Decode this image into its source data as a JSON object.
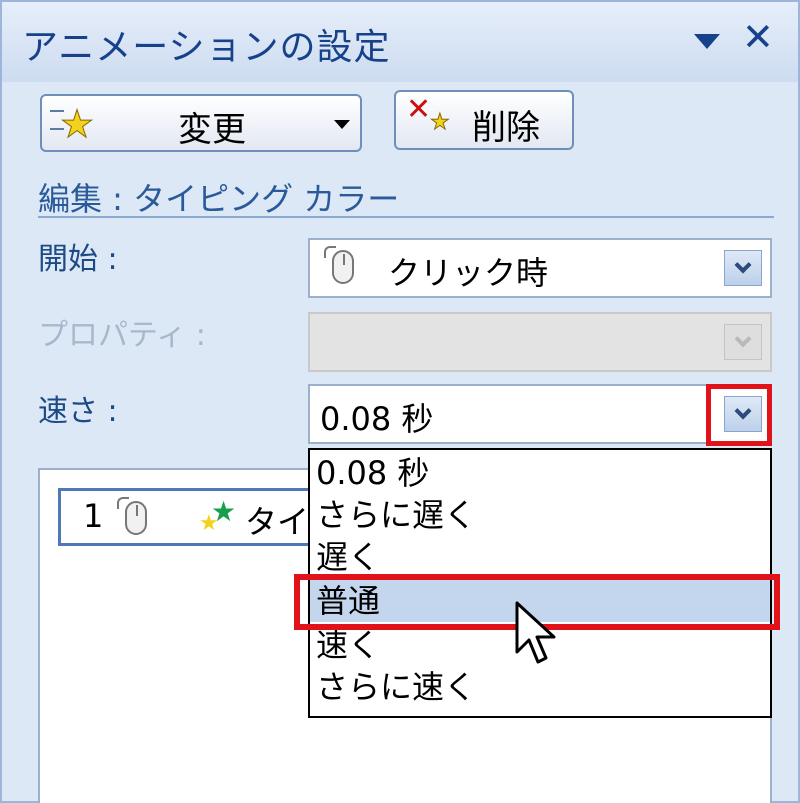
{
  "title": "アニメーションの設定",
  "buttons": {
    "change_label": "変更",
    "delete_label": "削除"
  },
  "section_title": "編集 : タイピング カラー",
  "fields": {
    "start_label": "開始 :",
    "start_value": "クリック時",
    "property_label": "プロパティ :",
    "property_value": "",
    "speed_label": "速さ :",
    "speed_value": "0.08 秒"
  },
  "speed_options": [
    "0.08 秒",
    "さらに遅く",
    "遅く",
    "普通",
    "速く",
    "さらに速く"
  ],
  "selected_option": "普通",
  "animation_list": [
    {
      "number": "1",
      "name": "タイピング カラー"
    }
  ],
  "icons": [
    "menu-arrow-icon",
    "close-icon",
    "star-icon",
    "x-icon",
    "mouse-icon",
    "chevron-down-icon",
    "pointer-cursor-icon"
  ],
  "colors": {
    "title_text": "#15428b",
    "pane_background": "#dce8f6",
    "highlight_red": "#e0131a",
    "selection": "#c3d6ee"
  }
}
